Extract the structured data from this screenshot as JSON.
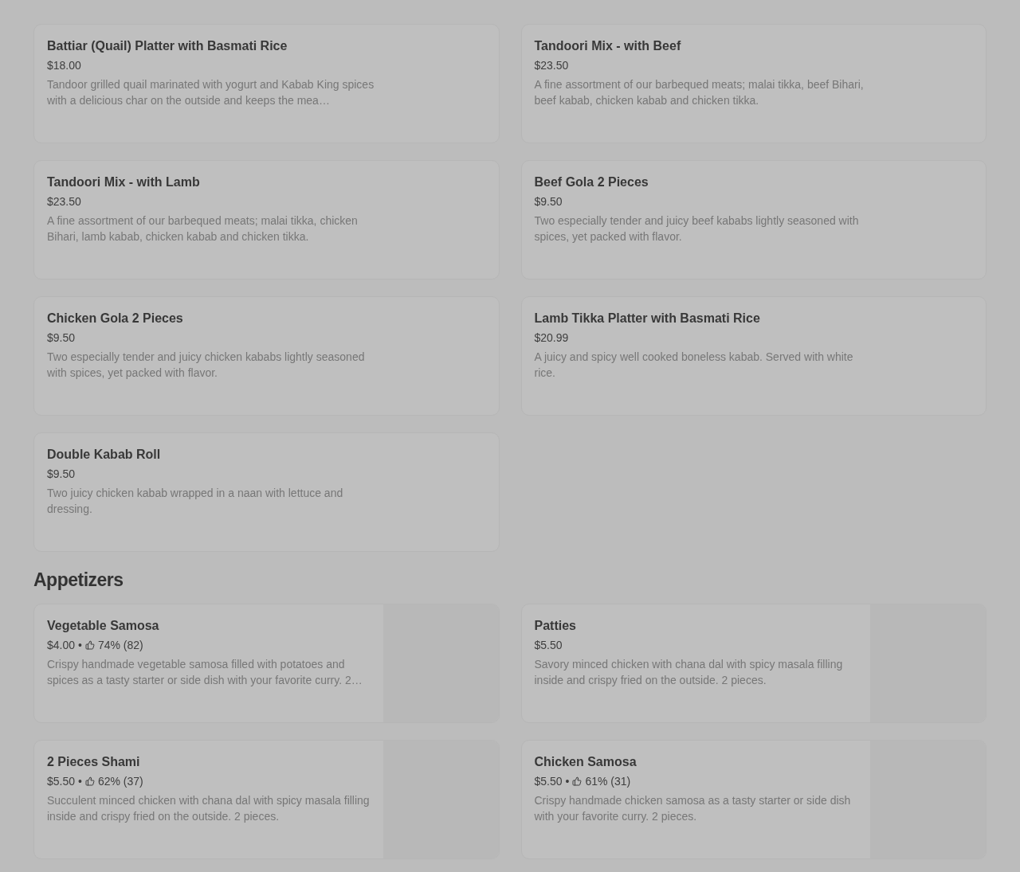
{
  "sections": [
    {
      "items": [
        {
          "name": "Battiar (Quail) Platter with Basmati Rice",
          "price": "$18.00",
          "description": "Tandoor grilled quail marinated with yogurt and Kabab King spices with a delicious char on the outside and keeps the mea…"
        },
        {
          "name": "Tandoori Mix - with Beef",
          "price": "$23.50",
          "description": "A fine assortment of our barbequed meats; malai tikka, beef Bihari, beef kabab, chicken kabab and chicken tikka."
        },
        {
          "name": "Tandoori Mix - with Lamb",
          "price": "$23.50",
          "description": "A fine assortment of our barbequed meats; malai tikka, chicken Bihari, lamb kabab, chicken kabab and chicken tikka."
        },
        {
          "name": "Beef Gola 2 Pieces",
          "price": "$9.50",
          "description": "Two especially tender and juicy beef kababs lightly seasoned with spices, yet packed with flavor."
        },
        {
          "name": "Chicken Gola 2 Pieces",
          "price": "$9.50",
          "description": "Two especially tender and juicy chicken kababs lightly seasoned with spices, yet packed with flavor."
        },
        {
          "name": "Lamb Tikka Platter with Basmati Rice",
          "price": "$20.99",
          "description": "A juicy and spicy well cooked boneless kabab. Served with white rice."
        },
        {
          "name": "Double Kabab Roll",
          "price": "$9.50",
          "description": "Two juicy chicken kabab wrapped in a naan with lettuce and dressing."
        }
      ]
    },
    {
      "title": "Appetizers",
      "items": [
        {
          "name": "Vegetable Samosa",
          "price": "$4.00",
          "separator": "•",
          "rating": "74% (82)",
          "description": "Crispy handmade vegetable samosa filled with potatoes and spices as a tasty starter or side dish with your favorite curry. 2…",
          "photo": true
        },
        {
          "name": "Patties",
          "price": "$5.50",
          "description": "Savory minced chicken with chana dal with spicy masala filling inside and crispy fried on the outside. 2 pieces.",
          "photo": true
        },
        {
          "name": "2 Pieces Shami",
          "price": "$5.50",
          "separator": "•",
          "rating": "62% (37)",
          "description": "Succulent minced chicken with chana dal with spicy masala filling inside and crispy fried on the outside. 2 pieces.",
          "photo": true
        },
        {
          "name": "Chicken Samosa",
          "price": "$5.50",
          "separator": "•",
          "rating": "61% (31)",
          "description": "Crispy handmade chicken samosa as a tasty starter or side dish with your favorite curry. 2 pieces.",
          "photo": true
        }
      ]
    }
  ]
}
